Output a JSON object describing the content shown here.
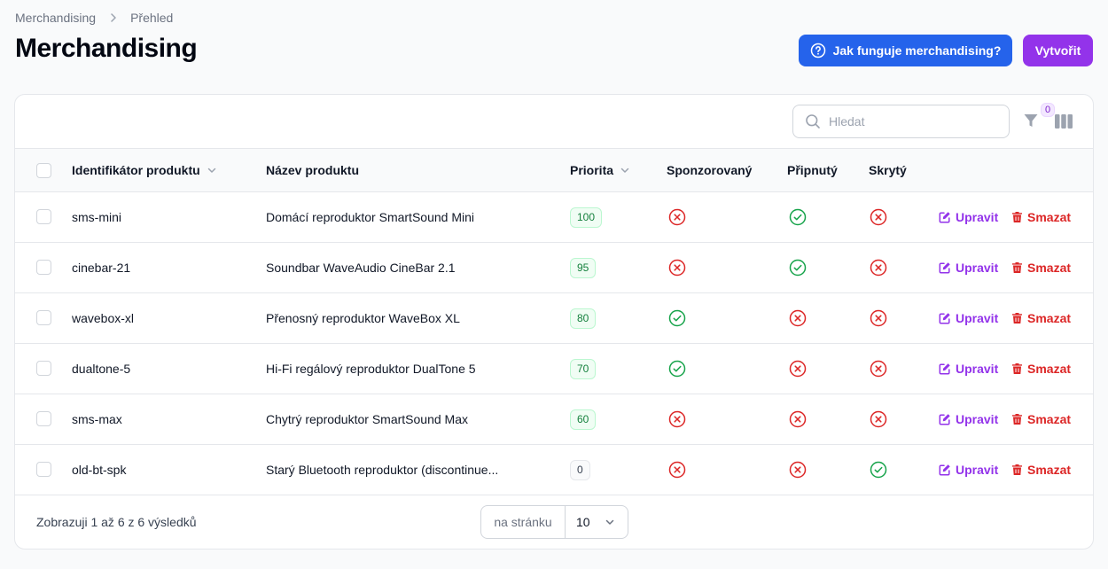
{
  "breadcrumb": {
    "parent": "Merchandising",
    "current": "Přehled"
  },
  "page": {
    "title": "Merchandising"
  },
  "header_actions": {
    "help_label": "Jak funguje merchandising?",
    "create_label": "Vytvořit"
  },
  "toolbar": {
    "search_placeholder": "Hledat",
    "filter_count": "0"
  },
  "table": {
    "columns": {
      "product_id": "Identifikátor produktu",
      "product_name": "Název produktu",
      "priority": "Priorita",
      "sponsored": "Sponzorovaný",
      "pinned": "Připnutý",
      "hidden": "Skrytý"
    },
    "edit_label": "Upravit",
    "delete_label": "Smazat",
    "rows": [
      {
        "id": "sms-mini",
        "name": "Domácí reproduktor SmartSound Mini",
        "priority": "100",
        "sponsored": false,
        "pinned": true,
        "hidden": false
      },
      {
        "id": "cinebar-21",
        "name": "Soundbar WaveAudio CineBar 2.1",
        "priority": "95",
        "sponsored": false,
        "pinned": true,
        "hidden": false
      },
      {
        "id": "wavebox-xl",
        "name": "Přenosný reproduktor WaveBox XL",
        "priority": "80",
        "sponsored": true,
        "pinned": false,
        "hidden": false
      },
      {
        "id": "dualtone-5",
        "name": "Hi-Fi regálový reproduktor DualTone 5",
        "priority": "70",
        "sponsored": true,
        "pinned": false,
        "hidden": false
      },
      {
        "id": "sms-max",
        "name": "Chytrý reproduktor SmartSound Max",
        "priority": "60",
        "sponsored": false,
        "pinned": false,
        "hidden": false
      },
      {
        "id": "old-bt-spk",
        "name": "Starý Bluetooth reproduktor (discontinue...",
        "priority": "0",
        "sponsored": false,
        "pinned": false,
        "hidden": true
      }
    ]
  },
  "footer": {
    "summary": "Zobrazuji 1 až 6 z 6 výsledků",
    "per_page_label": "na stránku",
    "per_page_value": "10"
  },
  "colors": {
    "primary_blue": "#2563eb",
    "accent_purple": "#9333ea",
    "success": "#16a34a",
    "danger": "#dc2626"
  }
}
